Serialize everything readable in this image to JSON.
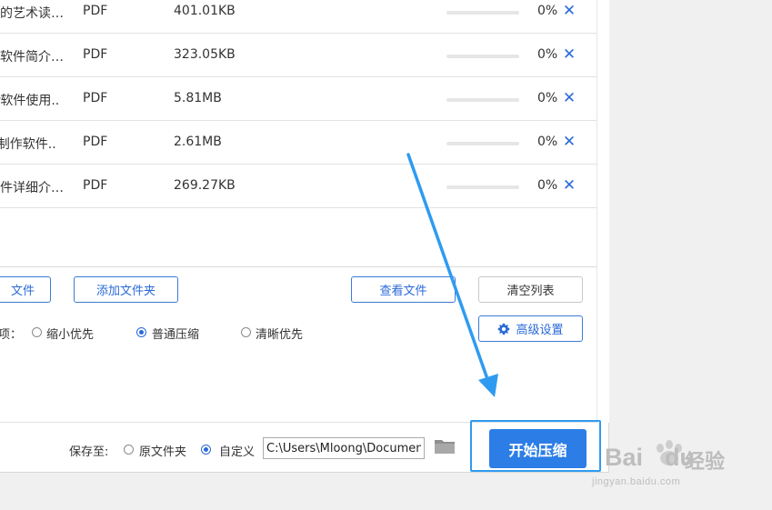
{
  "files": [
    {
      "name": "开的艺术读…",
      "type": "PDF",
      "size": "401.01KB",
      "progress_pct": 0,
      "percent_label": "0%"
    },
    {
      "name": "编软件简介…",
      "type": "PDF",
      "size": "323.05KB",
      "progress_pct": 0,
      "percent_label": "0%"
    },
    {
      "name": "ar软件使用..",
      "type": "PDF",
      "size": "5.81MB",
      "progress_pct": 0,
      "percent_label": "0%"
    },
    {
      "name": "D制作软件..",
      "type": "PDF",
      "size": "2.61MB",
      "progress_pct": 0,
      "percent_label": "0%"
    },
    {
      "name": "软件详细介…",
      "type": "PDF",
      "size": "269.27KB",
      "progress_pct": 0,
      "percent_label": "0%"
    }
  ],
  "remove_glyph": "✕",
  "buttons": {
    "add_file": "文件",
    "add_folder": "添加文件夹",
    "view_files": "查看文件",
    "clear_list": "清空列表",
    "advanced": "高级设置",
    "start": "开始压缩"
  },
  "options": {
    "prefix": "项：",
    "choices": [
      {
        "label": "缩小优先",
        "selected": false
      },
      {
        "label": "普通压缩",
        "selected": true
      },
      {
        "label": "清晰优先",
        "selected": false
      }
    ]
  },
  "save": {
    "label": "保存至:",
    "original_folder": "原文件夹",
    "original_selected": false,
    "custom": "自定义",
    "custom_selected": true,
    "path": "C:\\Users\\Mloong\\Documents"
  },
  "watermark": {
    "brand": "Bai",
    "brand_suffix": "du",
    "cn": "经验",
    "url": "jingyan.baidu.com"
  },
  "colors": {
    "accent": "#2c7ee6",
    "highlight_frame": "#2f9bf0",
    "arrow": "#2f9bf0"
  },
  "icons": {
    "remove": "close-icon",
    "settings": "gear-icon",
    "folder": "folder-icon"
  }
}
